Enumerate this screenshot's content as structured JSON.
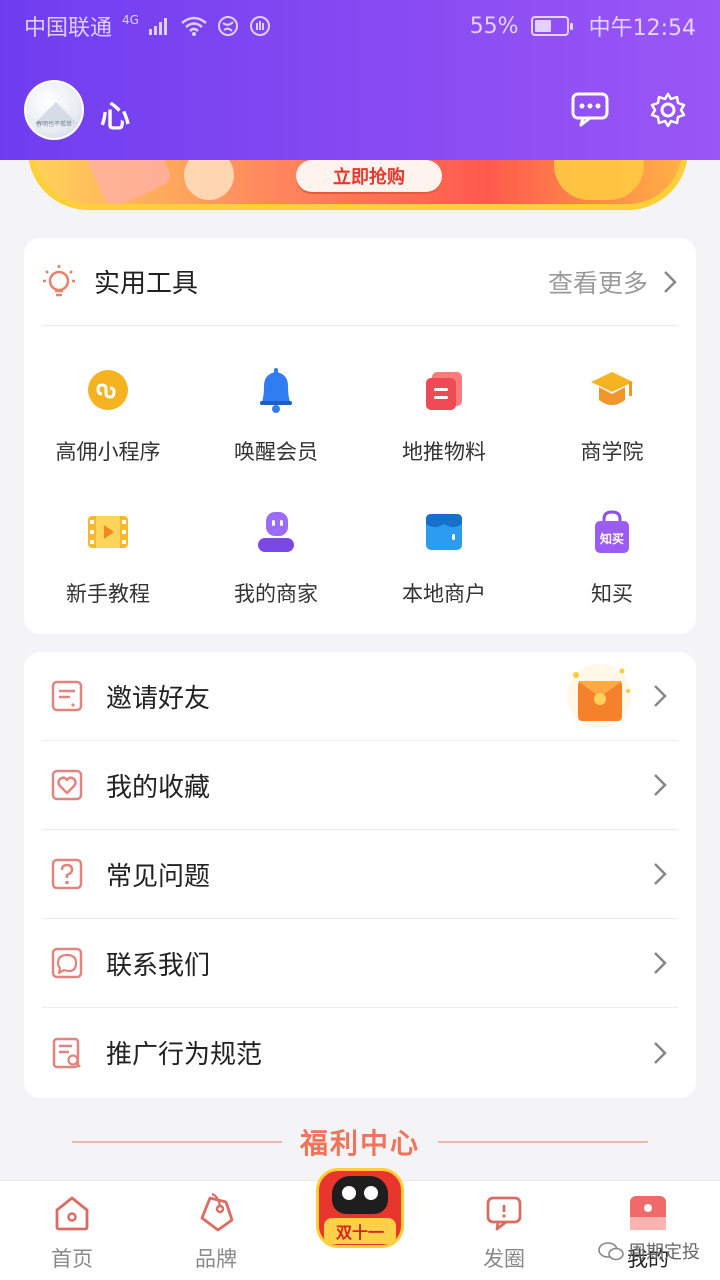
{
  "statusbar": {
    "carrier": "中国联通",
    "network": "4G",
    "battery": "55%",
    "time": "中午12:54"
  },
  "profile": {
    "username": "心",
    "avatar_caption": "春明也不孤单"
  },
  "banner": {
    "button_label": "立即抢购"
  },
  "tools": {
    "title": "实用工具",
    "more": "查看更多",
    "items": [
      {
        "label": "高佣小程序",
        "icon": "mini-program-icon"
      },
      {
        "label": "唤醒会员",
        "icon": "bell-icon"
      },
      {
        "label": "地推物料",
        "icon": "document-icon"
      },
      {
        "label": "商学院",
        "icon": "graduation-cap-icon"
      },
      {
        "label": "新手教程",
        "icon": "film-icon"
      },
      {
        "label": "我的商家",
        "icon": "merchant-icon"
      },
      {
        "label": "本地商户",
        "icon": "store-icon"
      },
      {
        "label": "知买",
        "icon": "shopping-bag-icon"
      }
    ],
    "bag_text": "知买"
  },
  "menu": {
    "items": [
      {
        "label": "邀请好友",
        "icon": "invite-icon"
      },
      {
        "label": "我的收藏",
        "icon": "heart-icon"
      },
      {
        "label": "常见问题",
        "icon": "question-icon"
      },
      {
        "label": "联系我们",
        "icon": "chat-icon"
      },
      {
        "label": "推广行为规范",
        "icon": "rules-icon"
      }
    ]
  },
  "welfare": {
    "title": "福利中心"
  },
  "bottomnav": {
    "items": [
      {
        "label": "首页"
      },
      {
        "label": "品牌"
      },
      {
        "label": "发圈"
      },
      {
        "label": "我的"
      }
    ],
    "center_badge": "双十一"
  },
  "watermark": "周期定投",
  "colors": {
    "header_start": "#6f3df0",
    "header_end": "#9a56f6",
    "accent": "#f0745a"
  }
}
